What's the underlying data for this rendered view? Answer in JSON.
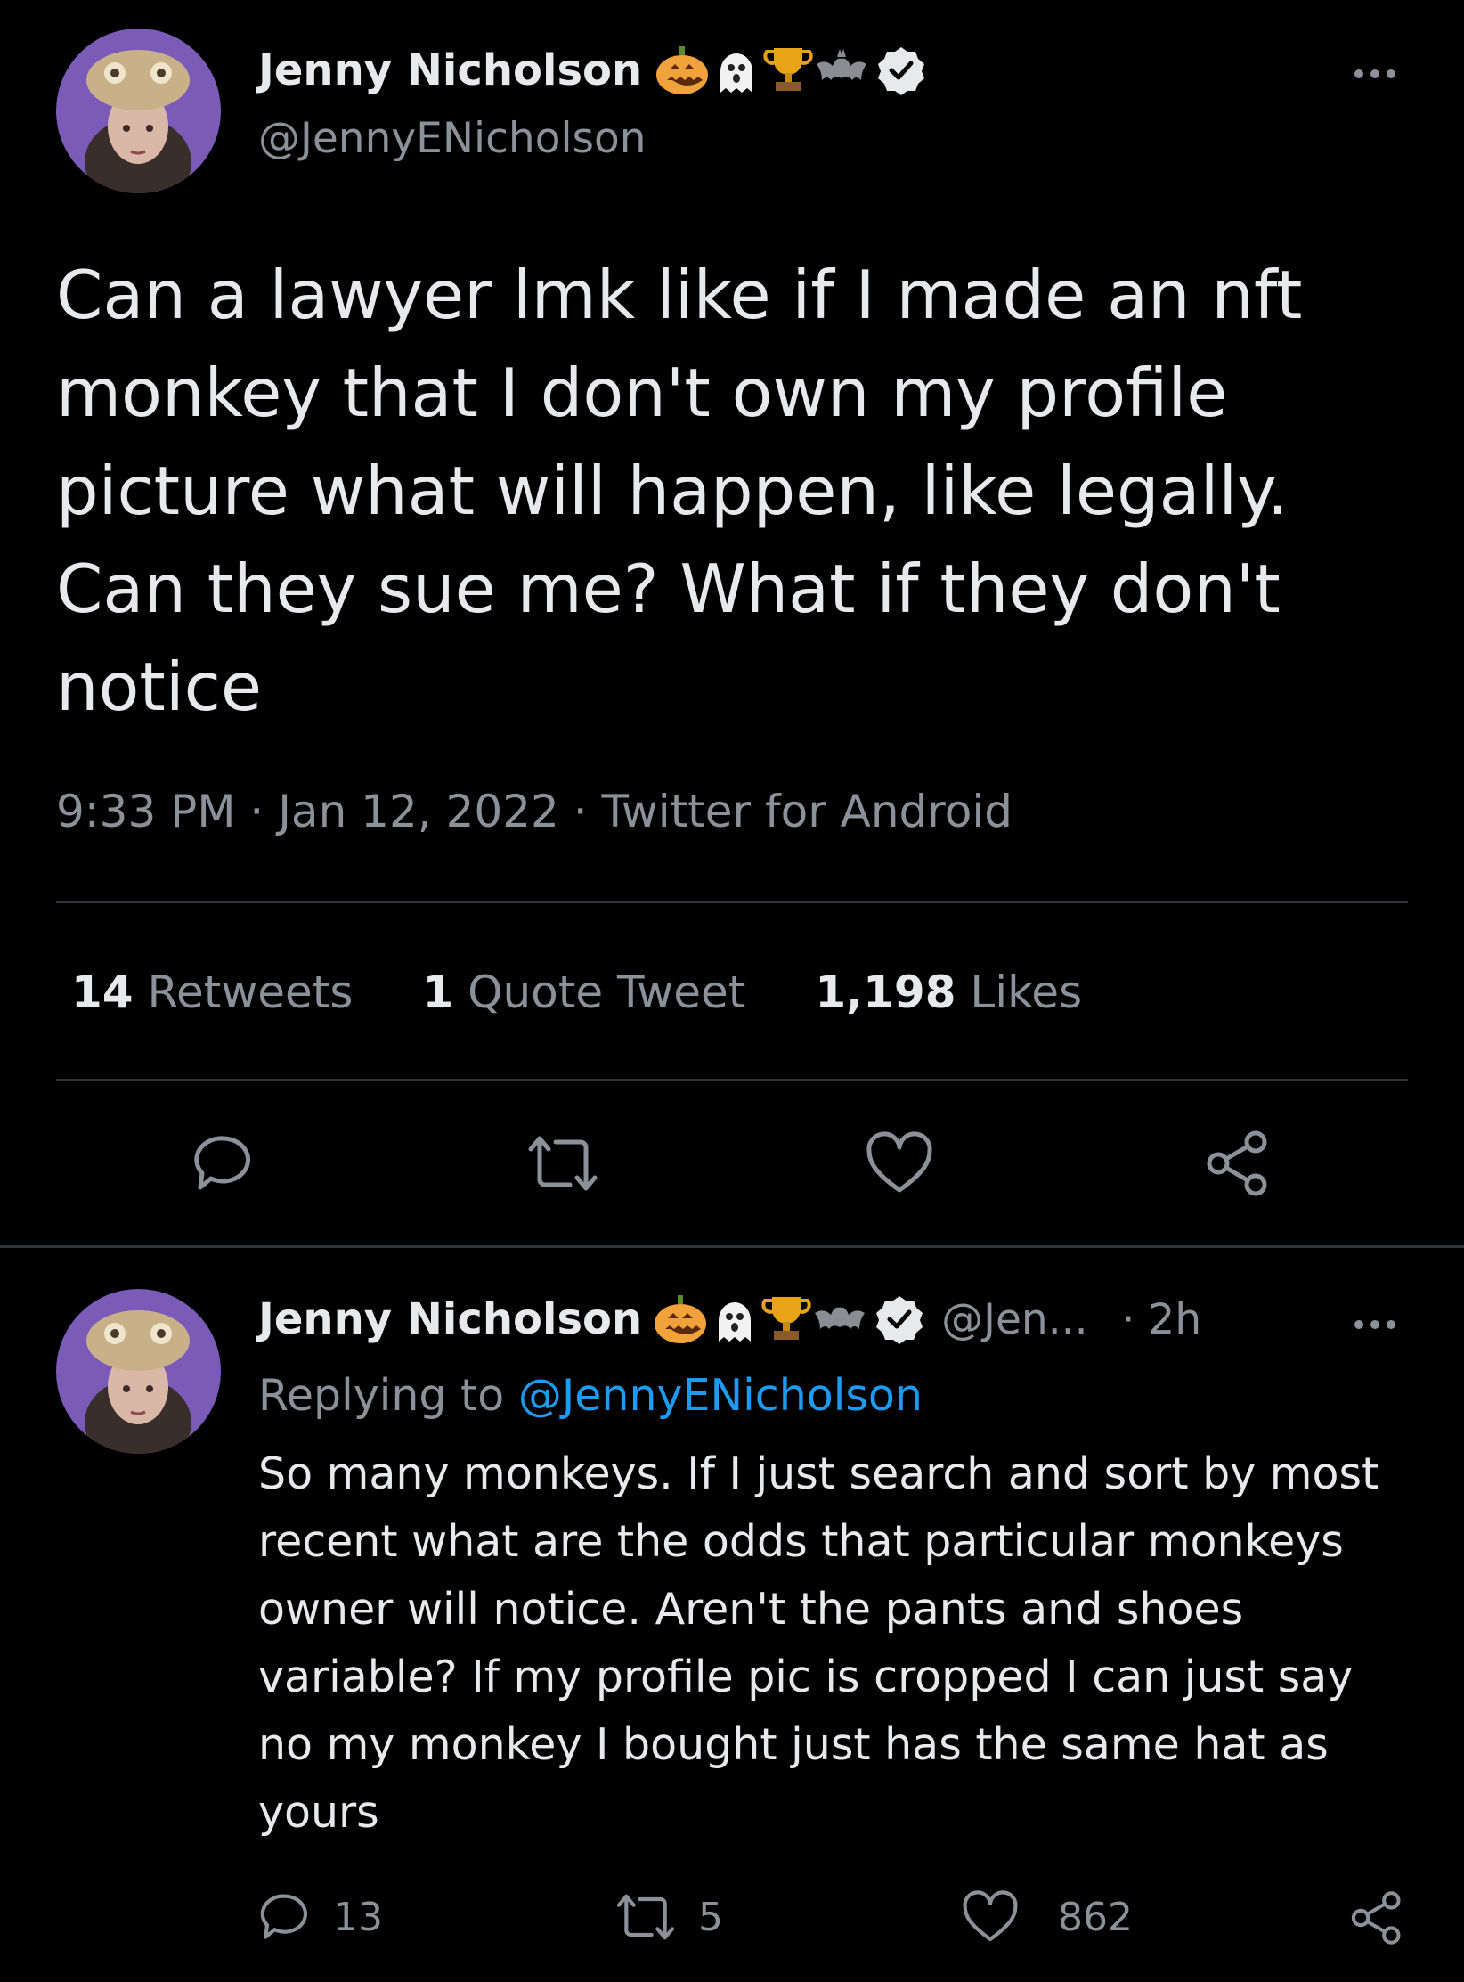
{
  "main_tweet": {
    "author_name": "Jenny Nicholson",
    "handle": "@JennyENicholson",
    "name_emojis": [
      "pumpkin-icon",
      "ghost-icon",
      "trophy-icon",
      "bat-icon"
    ],
    "text_lines": [
      "Can a lawyer lmk like if I made an nft",
      "monkey that I don't own my profile",
      "picture what will happen, like legally.",
      "Can they sue me? What if they don't",
      "notice"
    ],
    "time": "9:33 PM",
    "date": "Jan 12, 2022",
    "source": "Twitter for Android",
    "sep": "·",
    "retweets_count": "14",
    "retweets_label": "Retweets",
    "quotes_count": "1",
    "quotes_label": "Quote Tweet",
    "likes_count": "1,198",
    "likes_label": "Likes"
  },
  "reply_tweet": {
    "author_name": "Jenny Nicholson",
    "handle_truncated": "@Jen...",
    "time_ago": "· 2h",
    "replying_prefix": "Replying to",
    "replying_handle": "@JennyENicholson",
    "text_lines": [
      "So many monkeys. If I just search and sort by most",
      "recent what are the odds that particular monkeys",
      "owner will notice. Aren't the pants and shoes",
      "variable? If my profile pic is cropped I can just say",
      "no my monkey I bought just has the same hat as",
      "yours"
    ],
    "reply_count": "13",
    "retweet_count": "5",
    "like_count": "862"
  },
  "colors": {
    "background": "#000000",
    "text": "#e7e9ea",
    "muted": "#8b9199",
    "link": "#1d9bf0",
    "divider": "#2f3336",
    "avatar_bg": "#7b5bb8"
  }
}
